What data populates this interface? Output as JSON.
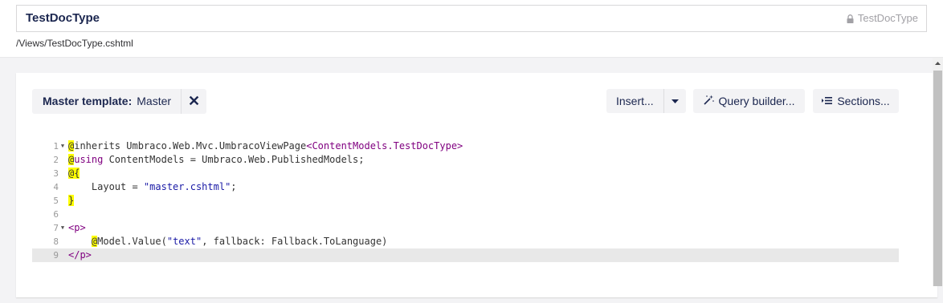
{
  "header": {
    "name_value": "TestDocType",
    "alias": "TestDocType",
    "path": "/Views/TestDocType.cshtml"
  },
  "toolbar": {
    "master_label": "Master template:",
    "master_value": "Master",
    "insert_label": "Insert...",
    "query_label": "Query builder...",
    "sections_label": "Sections..."
  },
  "editor": {
    "line_numbers": [
      "1",
      "2",
      "3",
      "4",
      "5",
      "6",
      "7",
      "8",
      "9"
    ],
    "line1": {
      "at": "@",
      "text": "inherits Umbraco.Web.Mvc.UmbracoViewPage",
      "generic": "<ContentModels.TestDocType>"
    },
    "line2": {
      "at": "@",
      "kw": "using",
      "text": " ContentModels = Umbraco.Web.PublishedModels;"
    },
    "line3": {
      "at": "@{"
    },
    "line4": {
      "pre": "    Layout = ",
      "str": "\"master.cshtml\"",
      "post": ";"
    },
    "line5": {
      "at": "}"
    },
    "line7": {
      "tag": "<p>"
    },
    "line8": {
      "indent": "    ",
      "at": "@",
      "pre": "Model.Value(",
      "str": "\"text\"",
      "post": ", fallback: Fallback.ToLanguage)"
    },
    "line9": {
      "tag": "</p>"
    },
    "active_line": 9
  },
  "colors": {
    "text": "#1b264f",
    "button_bg": "#f3f3f5",
    "razor_highlight": "#ffff00",
    "tag": "#800080",
    "string": "#1a1aa6"
  },
  "icons": {
    "alias_lock": "lock-icon",
    "master_remove": "close-icon",
    "insert_dropdown": "caret-down-icon",
    "query": "wand-icon",
    "sections": "list-icon"
  }
}
